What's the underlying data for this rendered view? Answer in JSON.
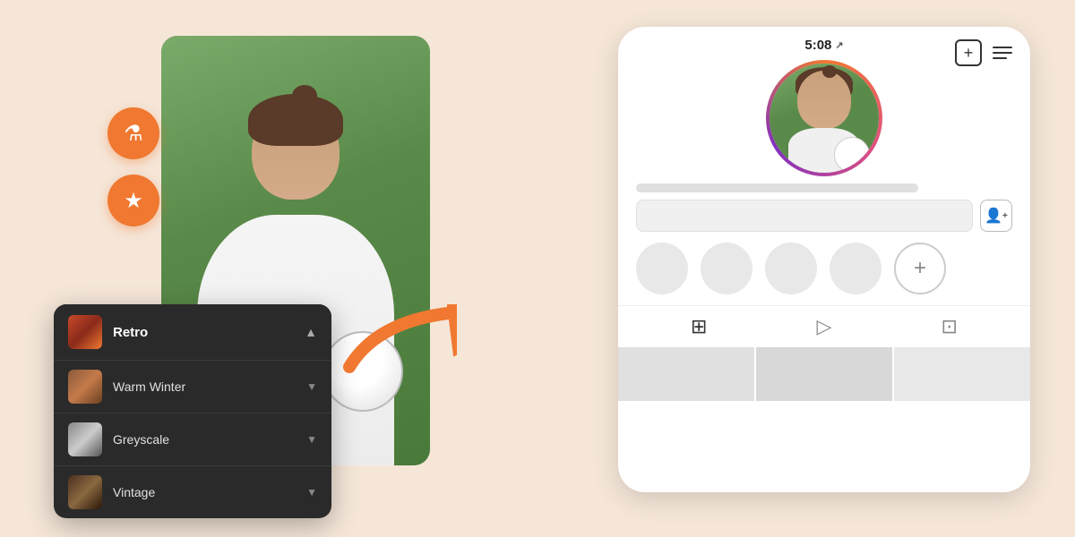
{
  "left": {
    "btn_flask_label": "⚗",
    "btn_star_label": "★"
  },
  "filter_panel": {
    "header_label": "Retro",
    "items": [
      {
        "label": "Warm Winter",
        "thumb_class": "thumb-warm"
      },
      {
        "label": "Greyscale",
        "thumb_class": "thumb-grey"
      },
      {
        "label": "Vintage",
        "thumb_class": "thumb-vintage"
      }
    ]
  },
  "phone": {
    "status_time": "5:08",
    "status_nav_icon": "↗",
    "plus_icon": "+",
    "menu_icon": "≡",
    "add_person_icon": "👤+",
    "stories_add_icon": "+",
    "tab_grid_icon": "⊞",
    "tab_play_icon": "▷",
    "tab_photo_icon": "⊡"
  }
}
